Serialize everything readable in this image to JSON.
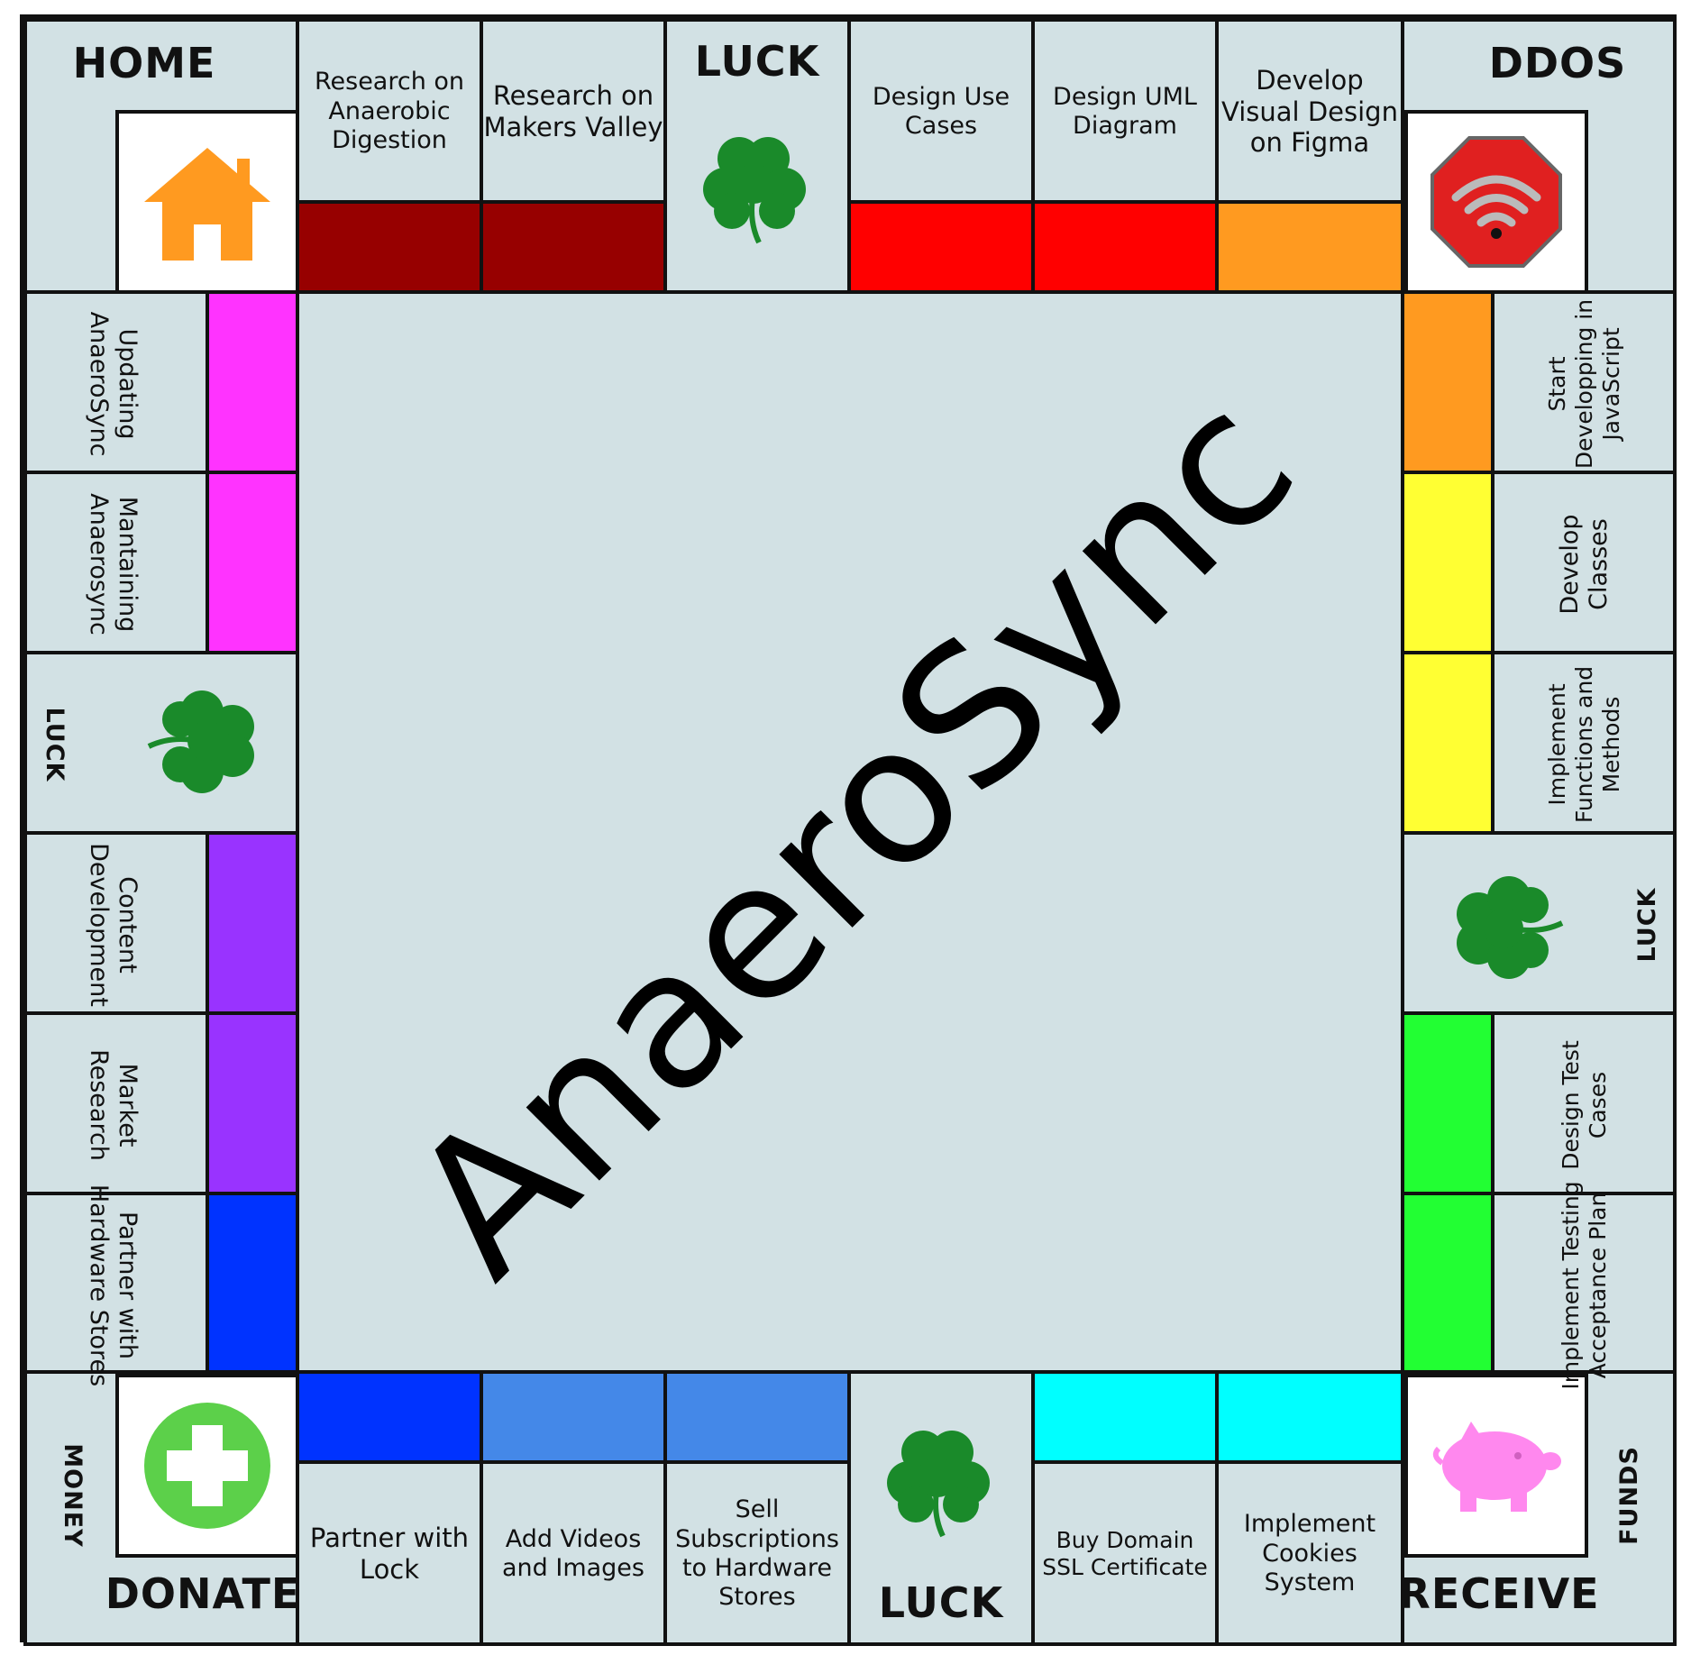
{
  "board": {
    "title": "AnaeroSync",
    "corners": {
      "home": "HOME",
      "ddos": "DDOS",
      "money": "MONEY",
      "donate": "DONATE",
      "receive": "RECEIVE",
      "funds": "FUNDS"
    },
    "luck_label": "LUCK",
    "top_spaces": [
      {
        "label": "Research on Anaerobic Digestion",
        "color": "#970000"
      },
      {
        "label": "Research on Makers Valley",
        "color": "#970000"
      },
      {
        "label": "Design Use Cases",
        "color": "#ff0000"
      },
      {
        "label": "Design UML Diagram",
        "color": "#ff0000"
      },
      {
        "label": "Develop Visual Design on Figma",
        "color": "#ff9a20"
      }
    ],
    "left_spaces": [
      {
        "label": "Updating AnaeroSync",
        "color": "#ff33ff"
      },
      {
        "label": "Mantaining Anaerosync",
        "color": "#ff33ff"
      },
      {
        "label": "Content Development",
        "color": "#9933ff"
      },
      {
        "label": "Market Research",
        "color": "#9933ff"
      },
      {
        "label": "Partner with Hardware Stores",
        "color": "#0033ff"
      }
    ],
    "right_spaces": [
      {
        "label": "Start Developping in JavaScript",
        "color": "#ff9a20"
      },
      {
        "label": "Develop Classes",
        "color": "#ffff33"
      },
      {
        "label": "Implement Functions and Methods",
        "color": "#ffff33"
      },
      {
        "label": "Design Test Cases",
        "color": "#22ff33"
      },
      {
        "label": "Implement Testing Acceptance Plan",
        "color": "#22ff33"
      }
    ],
    "bottom_spaces": [
      {
        "label": "Partner with Lock",
        "color": "#0033ff"
      },
      {
        "label": "Add Videos and Images",
        "color": "#4488e8"
      },
      {
        "label": "Sell Subscriptions to Hardware Stores",
        "color": "#4488e8"
      },
      {
        "label": "Buy Domain SSL Certificate",
        "color": "#00ffff"
      },
      {
        "label": "Implement Cookies System",
        "color": "#00ffff"
      }
    ],
    "icons": {
      "home": "house-icon",
      "ddos": "wifi-stop-icon",
      "donate": "medical-cross-icon",
      "receive": "piggy-bank-icon",
      "luck": "shamrock-icon"
    }
  }
}
